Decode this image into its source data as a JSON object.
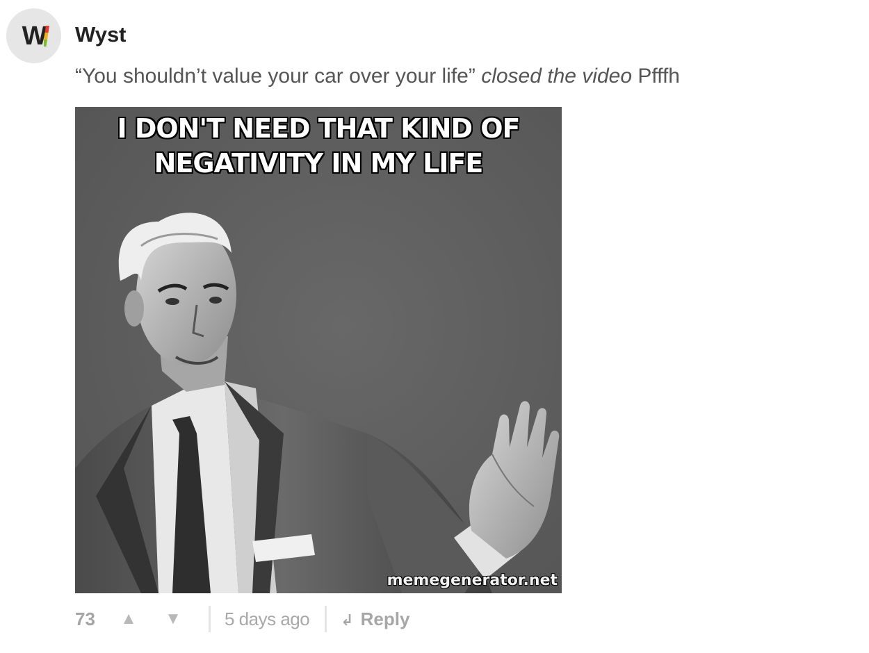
{
  "comment": {
    "author": "Wyst",
    "avatar_icon": "wyst-logo-icon",
    "body": {
      "quote": "“You shouldn’t value your car over your life”",
      "action": "closed the video",
      "tail": "Pfffh"
    },
    "meme": {
      "caption_line1": "I DON'T NEED THAT KIND OF",
      "caption_line2": "NEGATIVITY IN MY LIFE",
      "watermark": "memegenerator.net"
    },
    "footer": {
      "score": "73",
      "upvote_icon": "▲",
      "downvote_icon": "▼",
      "timestamp": "5 days ago",
      "reply_icon": "↲",
      "reply_label": "Reply"
    }
  },
  "colors": {
    "avatar_bg": "#e6e6e6",
    "author": "#222222",
    "body": "#555555",
    "meta": "#a7a7a7",
    "logo_stripes": [
      "#e53a2f",
      "#f2b01e",
      "#7dbb2f"
    ]
  }
}
